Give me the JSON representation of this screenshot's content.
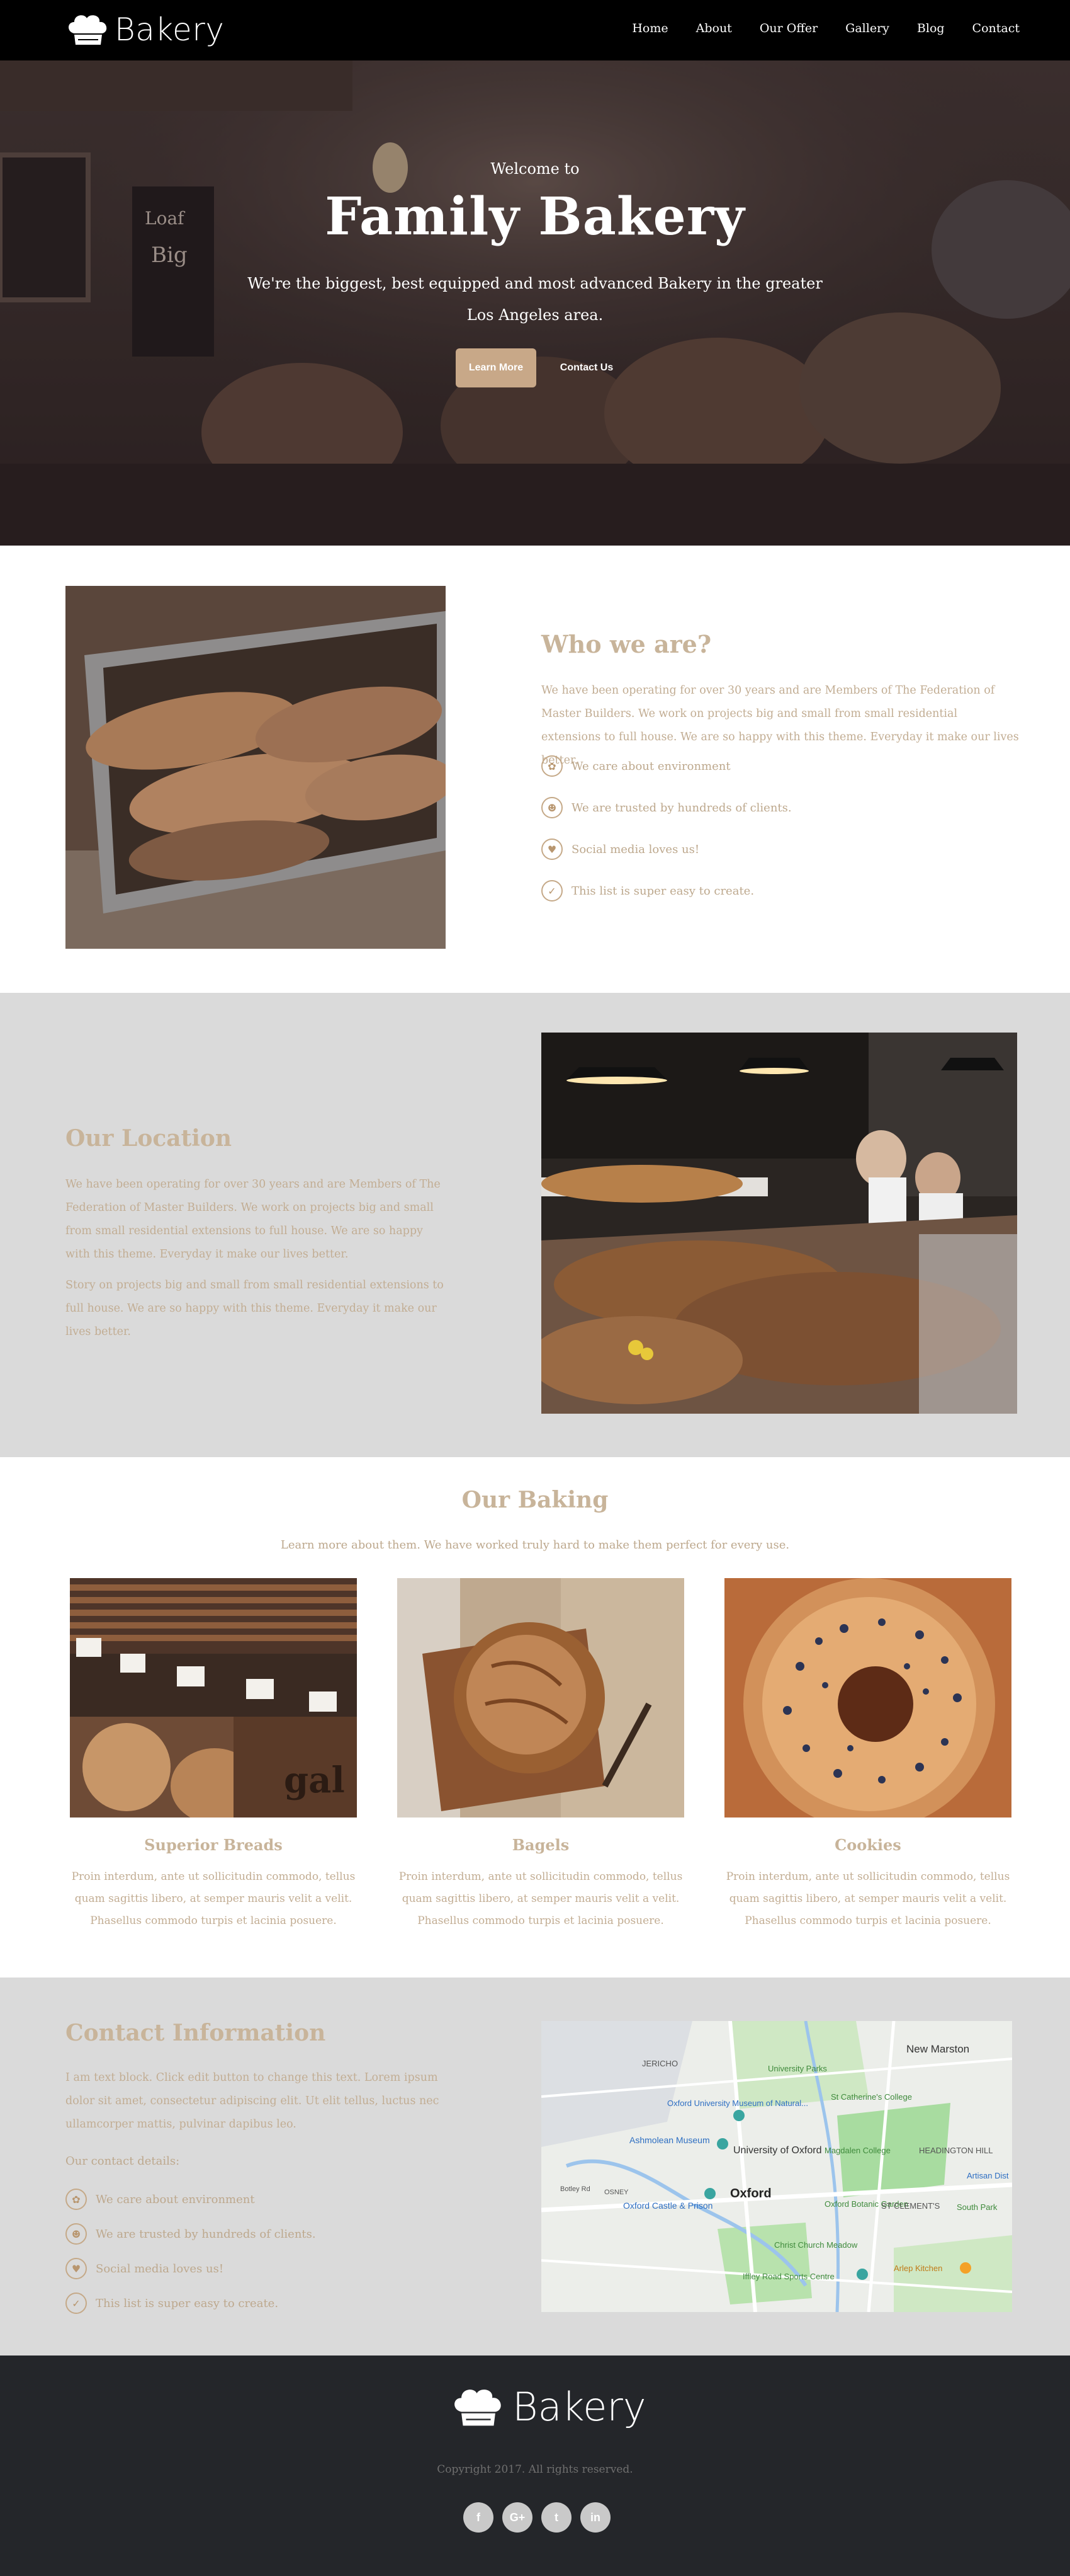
{
  "nav": {
    "brand": "Bakery",
    "items": [
      "Home",
      "About",
      "Our Offer",
      "Gallery",
      "Blog",
      "Contact"
    ]
  },
  "hero": {
    "welcome": "Welcome to",
    "title": "Family Bakery",
    "subtitle_line1": "We're the biggest, best equipped and most advanced Bakery in the greater",
    "subtitle_line2": "Los Angeles area.",
    "learn_more": "Learn More",
    "contact_us": "Contact Us"
  },
  "who": {
    "title": "Who we are?",
    "text": "We have been operating for over 30 years and are Members of The Federation of Master Builders. We work on projects big and small from small residential extensions to full house. We are so happy with this theme. Everyday it make our lives better.",
    "features": [
      {
        "icon": "leaf-icon",
        "label": "We care about environment"
      },
      {
        "icon": "users-icon",
        "label": "We are trusted by hundreds of clients."
      },
      {
        "icon": "heart-icon",
        "label": "Social media loves us!"
      },
      {
        "icon": "check-icon",
        "label": "This list is super easy to create."
      }
    ]
  },
  "location": {
    "title": "Our Location",
    "text1": "We have been operating for over 30 years and are Members of The Federation of Master Builders. We work on projects big and small from small residential extensions to full house. We are so happy with this theme. Everyday it make our lives better.",
    "text2": "Story on projects big and small from small residential extensions to full house. We are so happy with this theme. Everyday it make our lives better."
  },
  "baking": {
    "title": "Our Baking",
    "subtitle": "Learn more about them. We have worked truly hard to make them perfect for every use.",
    "cards": [
      {
        "title": "Superior Breads",
        "text": "Proin interdum, ante ut sollicitudin commodo, tellus quam sagittis libero, at semper mauris velit a velit. Phasellus commodo turpis et lacinia posuere."
      },
      {
        "title": "Bagels",
        "text": "Proin interdum, ante ut sollicitudin commodo, tellus quam sagittis libero, at semper mauris velit a velit. Phasellus commodo turpis et lacinia posuere."
      },
      {
        "title": "Cookies",
        "text": "Proin interdum, ante ut sollicitudin commodo, tellus quam sagittis libero, at semper mauris velit a velit. Phasellus commodo turpis et lacinia posuere."
      }
    ]
  },
  "contact": {
    "title": "Contact Information",
    "text": "I am text block. Click edit button to change this text. Lorem ipsum dolor sit amet, consectetur adipiscing elit. Ut elit tellus, luctus nec ullamcorper mattis, pulvinar dapibus leo.",
    "details_label": "Our contact details:",
    "features": [
      {
        "icon": "leaf-icon",
        "label": "We care about environment"
      },
      {
        "icon": "users-icon",
        "label": "We are trusted by hundreds of clients."
      },
      {
        "icon": "heart-icon",
        "label": "Social media loves us!"
      },
      {
        "icon": "check-icon",
        "label": "This list is super easy to create."
      }
    ],
    "map_labels": {
      "jericho": "JERICHO",
      "new_marston": "New Marston",
      "parks": "University Parks",
      "museum": "Oxford University Museum of Natural...",
      "ashmolean": "Ashmolean Museum",
      "catherine": "St Catherine's College",
      "oxford": "Oxford",
      "uni": "University of Oxford",
      "magdalen": "Magdalen College",
      "headington": "HEADINGTON HILL",
      "castle": "Oxford Castle & Prison",
      "botanic": "Oxford Botanic Garden",
      "clements": "ST CLEMENT'S",
      "christ": "Christ Church Meadow",
      "iffley": "Iffley Road Sports Centre",
      "artisan": "Artisan Dist",
      "south_park": "South Park",
      "kitchen": "Arlep Kitchen",
      "osney": "OSNEY",
      "botley": "Botley Rd"
    }
  },
  "footer": {
    "brand": "Bakery",
    "copyright": "Copyright 2017. All rights reserved.",
    "social": [
      {
        "icon": "facebook-icon",
        "glyph": "f"
      },
      {
        "icon": "google-plus-icon",
        "glyph": "G+"
      },
      {
        "icon": "twitter-icon",
        "glyph": "t"
      },
      {
        "icon": "linkedin-icon",
        "glyph": "in"
      }
    ]
  },
  "colors": {
    "accent": "#c8a888",
    "text_muted": "#c2ad93",
    "section_gray": "#dadada",
    "footer_bg": "#24262a"
  }
}
